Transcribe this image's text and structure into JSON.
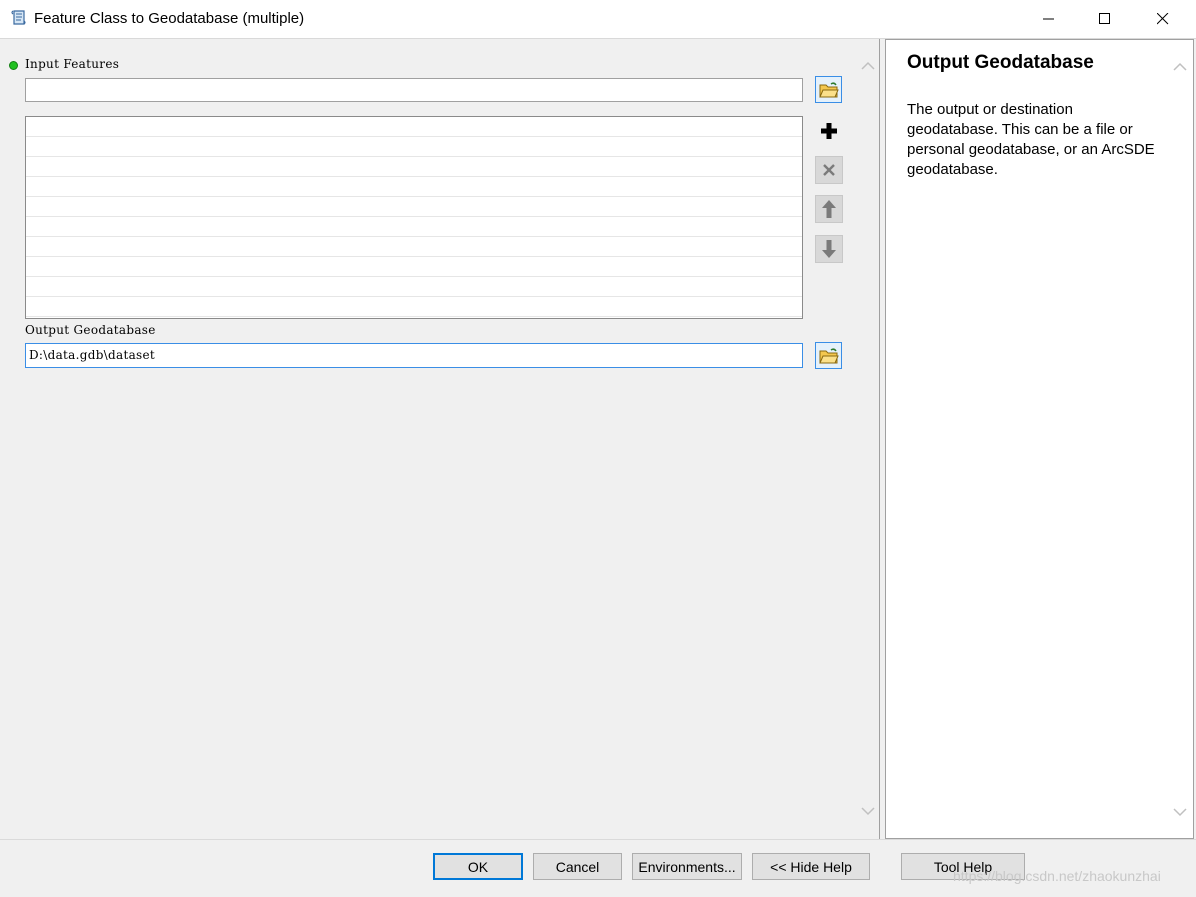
{
  "window": {
    "title": "Feature Class to Geodatabase (multiple)"
  },
  "params": {
    "input_label": "Input Features",
    "input_value": "",
    "output_label": "Output Geodatabase",
    "output_value": "D:\\data.gdb\\dataset"
  },
  "list": {
    "rows": [
      "",
      "",
      "",
      "",
      "",
      "",
      "",
      "",
      "",
      ""
    ]
  },
  "help": {
    "title": "Output Geodatabase",
    "body": "The output or destination geodatabase. This can be a file or personal geodatabase, or an ArcSDE geodatabase."
  },
  "buttons": {
    "ok": "OK",
    "cancel": "Cancel",
    "environments": "Environments...",
    "hide_help": "<< Hide Help",
    "tool_help": "Tool Help"
  },
  "watermark": "https://blog.csdn.net/zhaokunzhai",
  "colors": {
    "required_dot": "#21c021",
    "focus_border": "#3a8ee6",
    "ok_border": "#0078d7"
  },
  "icons": [
    "app-scroll-icon",
    "minimize-icon",
    "maximize-icon",
    "close-icon",
    "folder-open-icon",
    "add-icon",
    "delete-icon",
    "move-up-icon",
    "move-down-icon",
    "scroll-up-icon",
    "scroll-down-icon"
  ]
}
